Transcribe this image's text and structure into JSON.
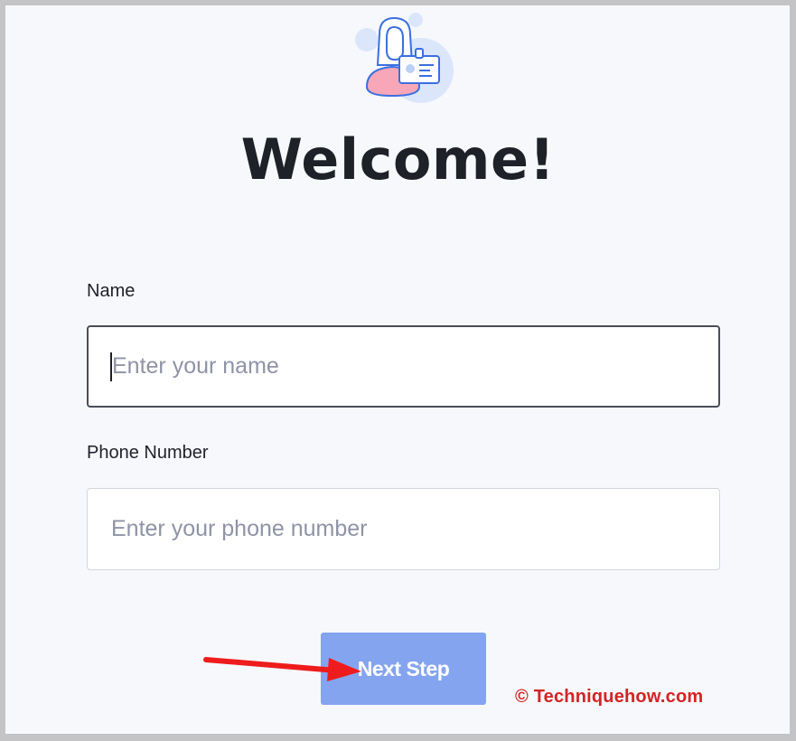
{
  "page": {
    "title": "Welcome!"
  },
  "form": {
    "name_label": "Name",
    "name_placeholder": "Enter your name",
    "name_value": "",
    "phone_label": "Phone Number",
    "phone_placeholder": "Enter your phone number",
    "phone_value": "",
    "next_label": "Next Step"
  },
  "watermark": {
    "text": "© Techniquehow.com"
  },
  "icons": {
    "illustration": "woman-id-card-icon",
    "annotation": "red-arrow"
  },
  "colors": {
    "background": "#f7f8fc",
    "button": "#85a4f0",
    "title": "#1f2128",
    "watermark": "#d42323",
    "arrow": "#ee1c1c"
  }
}
